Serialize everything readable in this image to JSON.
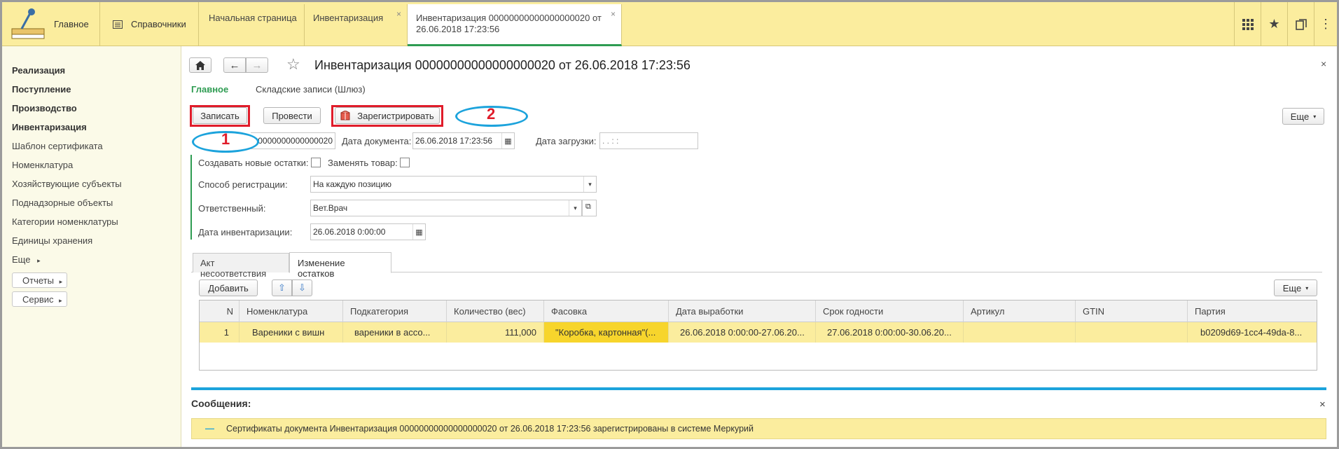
{
  "topbar": {
    "home_label": "Главное",
    "ref_label": "Справочники",
    "tabs": [
      {
        "label": "Начальная страница"
      },
      {
        "label": "Инвентаризация",
        "close": "×"
      },
      {
        "label": "Инвентаризация 00000000000000000020 от 26.06.2018 17:23:56",
        "close": "×"
      }
    ]
  },
  "sidebar": {
    "items": [
      {
        "label": "Реализация"
      },
      {
        "label": "Поступление"
      },
      {
        "label": "Производство"
      },
      {
        "label": "Инвентаризация"
      },
      {
        "label": "Шаблон сертификата"
      },
      {
        "label": "Номенклатура"
      },
      {
        "label": "Хозяйствующие субъекты"
      },
      {
        "label": "Поднадзорные объекты"
      },
      {
        "label": "Категории номенклатуры"
      },
      {
        "label": "Единицы хранения"
      },
      {
        "label": "Еще"
      }
    ],
    "reports_label": "Отчеты",
    "service_label": "Сервис"
  },
  "doc": {
    "title": "Инвентаризация 00000000000000000020 от 26.06.2018 17:23:56",
    "close": "×",
    "subtabs": [
      "Главное",
      "Складские записи (Шлюз)"
    ],
    "toolbar": {
      "save": "Записать",
      "post": "Провести",
      "register": "Зарегистрировать",
      "more": "Еще"
    },
    "annotations": {
      "one": "1",
      "two": "2"
    },
    "fields": {
      "number_value": "0000000000000020",
      "date_label": "Дата документа:",
      "date_value": "26.06.2018 17:23:56",
      "load_label": "Дата загрузки:",
      "load_value": "  .  .     :  :",
      "new_rest_label": "Создавать новые остатки:",
      "replace_label": "Заменять товар:",
      "reg_method_label": "Способ регистрации:",
      "reg_method_value": "На каждую позицию",
      "responsible_label": "Ответственный:",
      "responsible_value": "Вет.Врач",
      "inv_date_label": "Дата инвентаризации:",
      "inv_date_value": "26.06.2018  0:00:00"
    },
    "pages": [
      "Акт несоответствия",
      "Изменение остатков"
    ],
    "table_toolbar": {
      "add": "Добавить",
      "more": "Еще"
    },
    "table": {
      "headers": [
        "N",
        "Номенклатура",
        "Подкатегория",
        "Количество (вес)",
        "Фасовка",
        "Дата выработки",
        "Срок годности",
        "Артикул",
        "GTIN",
        "Партия"
      ],
      "rows": [
        [
          "1",
          "Вареники с вишн",
          "вареники в ассо...",
          "111,000",
          "\"Коробка, картонная\"(...",
          "26.06.2018 0:00:00-27.06.20...",
          "27.06.2018 0:00:00-30.06.20...",
          "",
          "",
          "b0209d69-1cc4-49da-8..."
        ]
      ]
    },
    "messages": {
      "title": "Сообщения:",
      "close": "×",
      "text": "Сертификаты документа Инвентаризация 00000000000000000020 от 26.06.2018 17:23:56 зарегистрированы в системе Меркурий"
    }
  },
  "colors": {
    "accent_green": "#2e9c52",
    "annotation_red": "#e01c2a",
    "annotation_blue": "#1ca3dc",
    "topbar": "#fbed9e"
  }
}
